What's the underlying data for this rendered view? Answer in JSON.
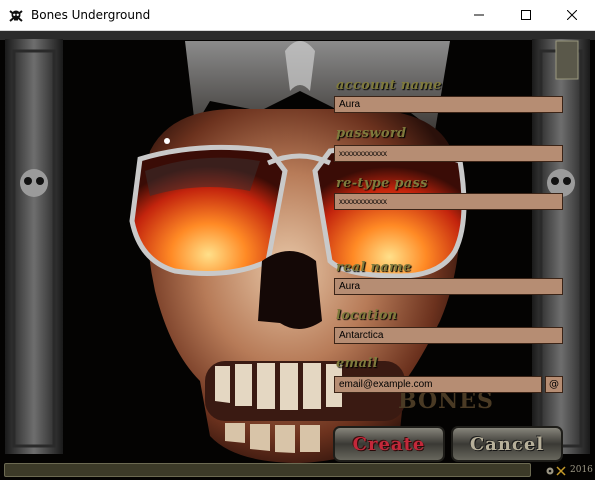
{
  "window": {
    "title": "Bones Underground",
    "controls": [
      "minimize",
      "maximize",
      "close"
    ]
  },
  "form": {
    "fields": [
      {
        "label": "account name",
        "value": "Aura"
      },
      {
        "label": "password",
        "value": "xxxxxxxxxxxx"
      },
      {
        "label": "re-type pass",
        "value": "xxxxxxxxxxxx"
      },
      {
        "label": "real name",
        "value": "Aura"
      },
      {
        "label": "location",
        "value": "Antarctica"
      },
      {
        "label": "email",
        "value": "email@example.com"
      }
    ],
    "email_helper": "@"
  },
  "buttons": {
    "create": "Create",
    "cancel": "Cancel"
  },
  "branding": {
    "logo_text": "BONES"
  },
  "footer": {
    "year": "2016"
  },
  "colors": {
    "field_bg": "#b68d73",
    "label": "#7f7a3c",
    "create": "#c3283a",
    "cancel": "#b7b09a"
  }
}
